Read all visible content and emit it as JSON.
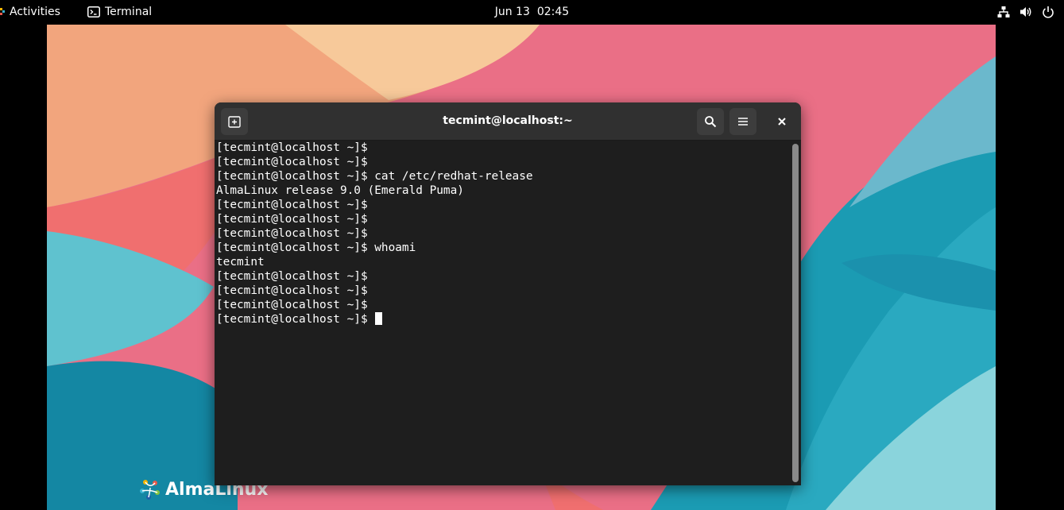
{
  "topbar": {
    "activities_label": "Activities",
    "app_name": "Terminal",
    "date": "Jun 13",
    "time": "02:45",
    "icons": [
      "terminal-app-icon",
      "network-icon",
      "volume-icon",
      "power-icon"
    ]
  },
  "desktop": {
    "logo_text": "AlmaLinux",
    "colors": {
      "peach": "#f2a57d",
      "pink": "#ea6f86",
      "coral": "#f06f6f",
      "teal": "#1b9bb3",
      "light_teal": "#8ad4dc"
    }
  },
  "window": {
    "title": "tecmint@localhost:~",
    "buttons": [
      "new-tab-button",
      "search-button",
      "menu-button",
      "close-button"
    ],
    "header_color": "#303030",
    "terminal_bg": "#1e1e1e"
  },
  "terminal": {
    "lines": [
      "[tecmint@localhost ~]$",
      "[tecmint@localhost ~]$",
      "[tecmint@localhost ~]$ cat /etc/redhat-release",
      "AlmaLinux release 9.0 (Emerald Puma)",
      "[tecmint@localhost ~]$",
      "[tecmint@localhost ~]$",
      "[tecmint@localhost ~]$",
      "[tecmint@localhost ~]$ whoami",
      "tecmint",
      "[tecmint@localhost ~]$",
      "[tecmint@localhost ~]$",
      "[tecmint@localhost ~]$",
      "[tecmint@localhost ~]$"
    ]
  }
}
